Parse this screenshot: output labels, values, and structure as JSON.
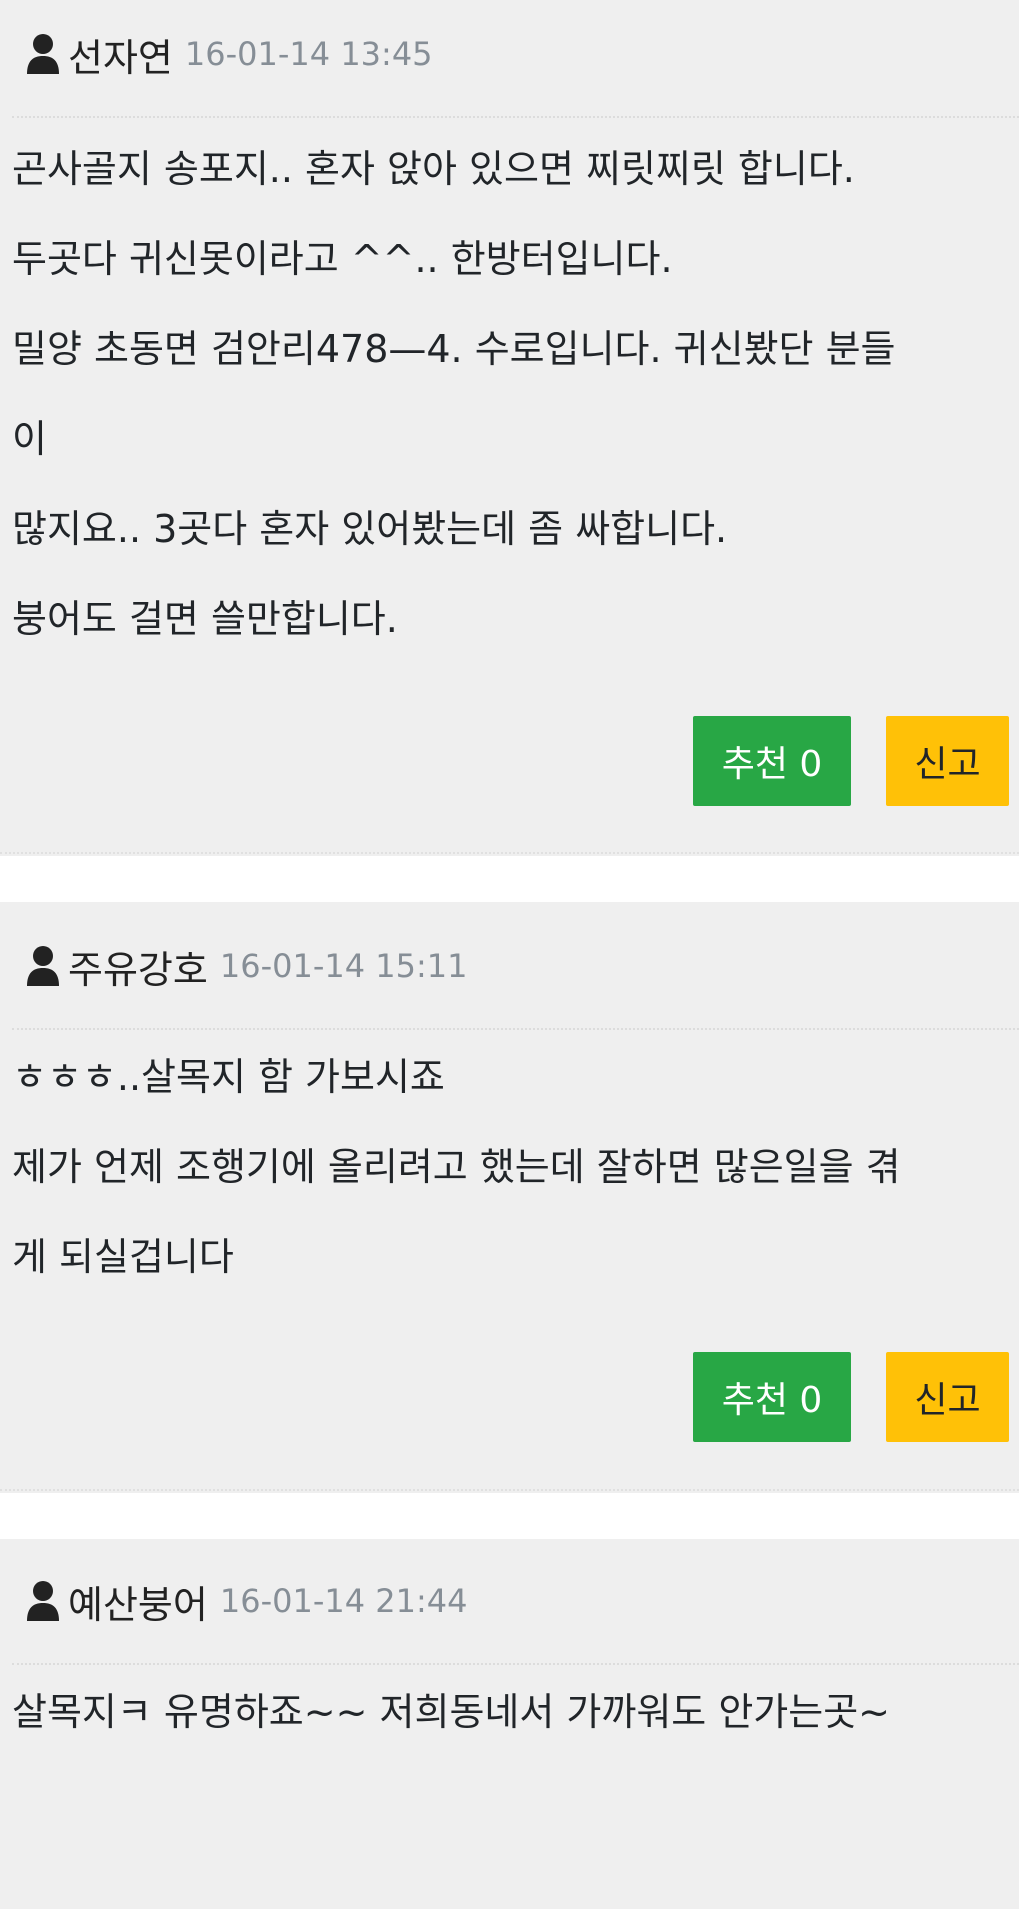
{
  "comments": [
    {
      "nickname": "선자연",
      "date": "16-01-14 13:45",
      "lines": [
        "곤사골지 송포지.. 혼자 앉아 있으면 찌릿찌릿 합니다.",
        "두곳다 귀신못이라고 ^^.. 한방터입니다.",
        "밀양 초동면 검안리478—4. 수로입니다. 귀신봤단 분들",
        "이",
        "많지요.. 3곳다 혼자 있어봤는데 좀 싸합니다.",
        "붕어도 걸면 쓸만합니다."
      ],
      "recommend_label": "추천 0",
      "report_label": "신고"
    },
    {
      "nickname": "주유강호",
      "date": "16-01-14 15:11",
      "lines": [
        "ㅎㅎㅎ..살목지 함 가보시죠",
        "제가 언제 조행기에 올리려고 했는데 잘하면 많은일을 겪",
        "게 되실겁니다"
      ],
      "recommend_label": "추천 0",
      "report_label": "신고"
    },
    {
      "nickname": "예산붕어",
      "date": "16-01-14 21:44",
      "lines": [
        "살목지ㅋ 유명하죠~~ 저희동네서 가까워도 안가는곳~"
      ]
    }
  ],
  "icons": {
    "user": "user-icon"
  },
  "colors": {
    "recommend": "#28a745",
    "report": "#ffc107",
    "comment_bg": "#efefef",
    "date": "#868e96"
  }
}
